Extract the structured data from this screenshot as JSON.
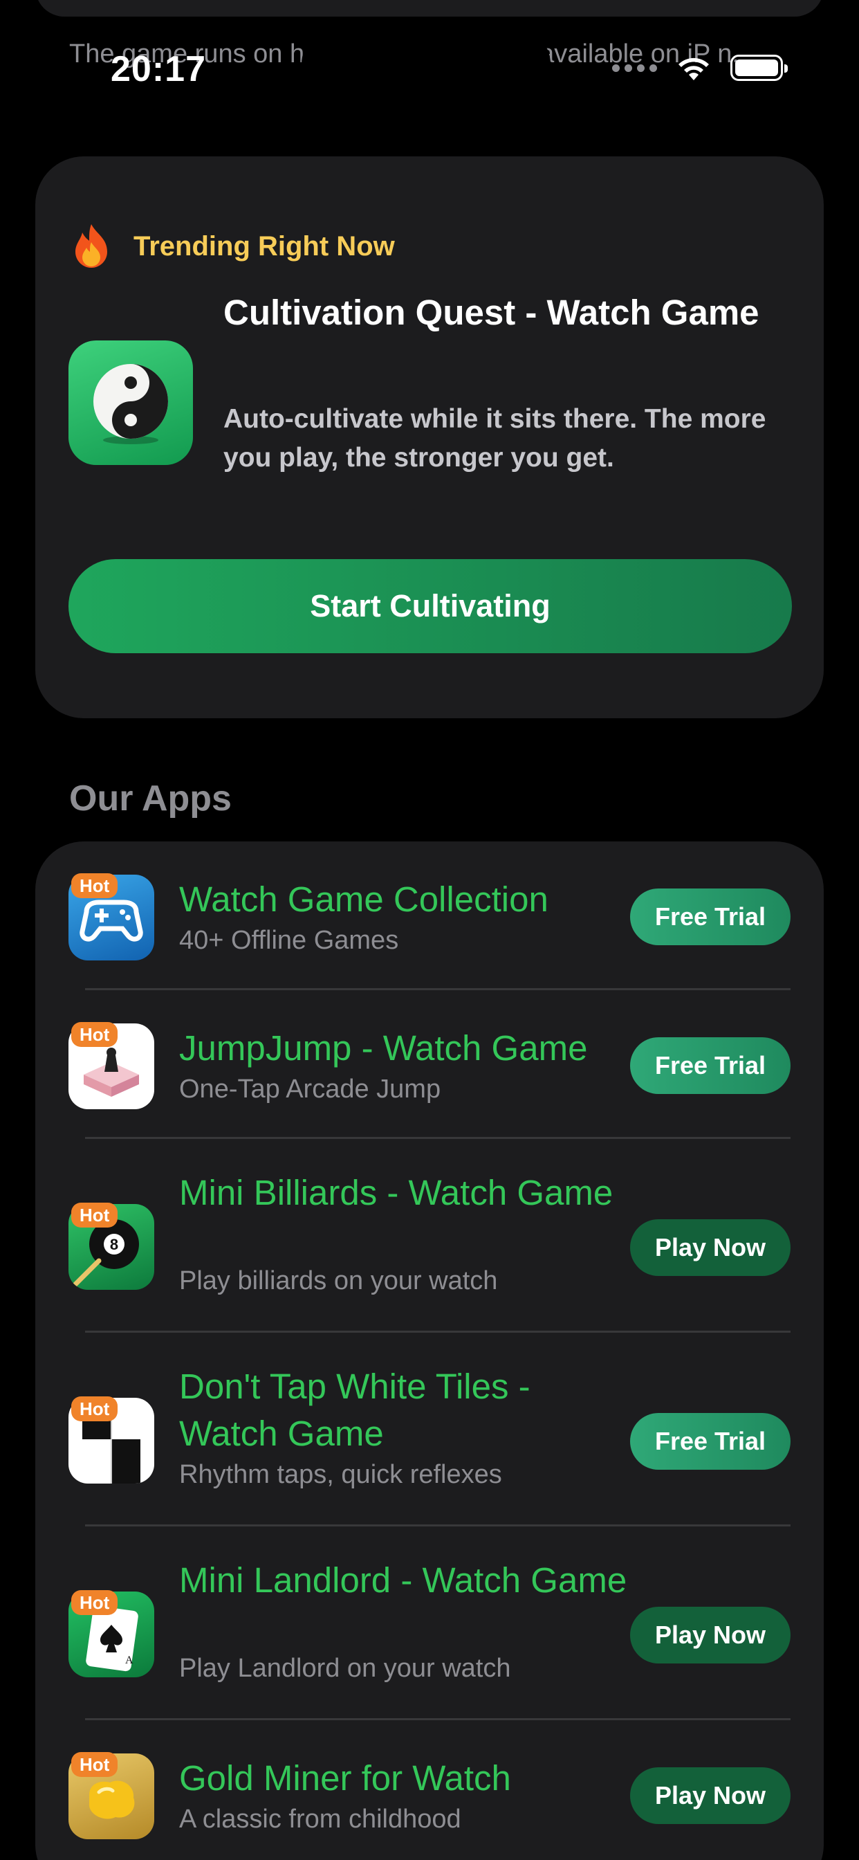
{
  "status_bar": {
    "time": "20:17"
  },
  "previous_card": {
    "text": "The game runs on                                    hase and restore are available on iP                                    n."
  },
  "trending": {
    "label": "Trending Right Now",
    "title": "Cultivation Quest - Watch Game",
    "description": "Auto-cultivate while it sits there. The more you play, the stronger you get.",
    "button_label": "Start Cultivating"
  },
  "section": {
    "title": "Our Apps"
  },
  "apps": [
    {
      "badge": "Hot",
      "name": "Watch Game Collection",
      "subtitle": "40+ Offline Games",
      "action": "Free Trial",
      "icon": "gamepad-icon"
    },
    {
      "badge": "Hot",
      "name": "JumpJump - Watch Game",
      "subtitle": "One-Tap Arcade Jump",
      "action": "Free Trial",
      "icon": "jump-platform-icon"
    },
    {
      "badge": "Hot",
      "name": "Mini Billiards - Watch Game",
      "subtitle": "Play billiards on your watch",
      "action": "Play Now",
      "icon": "billiard-ball-icon"
    },
    {
      "badge": "Hot",
      "name": "Don't Tap White Tiles - Watch Game",
      "subtitle": "Rhythm taps, quick reflexes",
      "action": "Free Trial",
      "icon": "piano-tiles-icon"
    },
    {
      "badge": "Hot",
      "name": "Mini Landlord - Watch Game",
      "subtitle": "Play Landlord on your watch",
      "action": "Play Now",
      "icon": "playing-card-icon"
    },
    {
      "badge": "Hot",
      "name": "Gold Miner for Watch",
      "subtitle": "A classic from childhood",
      "action": "Play Now",
      "icon": "gold-nugget-icon"
    }
  ],
  "colors": {
    "background": "#000000",
    "card": "#1c1c1e",
    "accent_green": "#34c759",
    "trending_yellow": "#f7cc58",
    "hot_badge": "#f0832a"
  }
}
